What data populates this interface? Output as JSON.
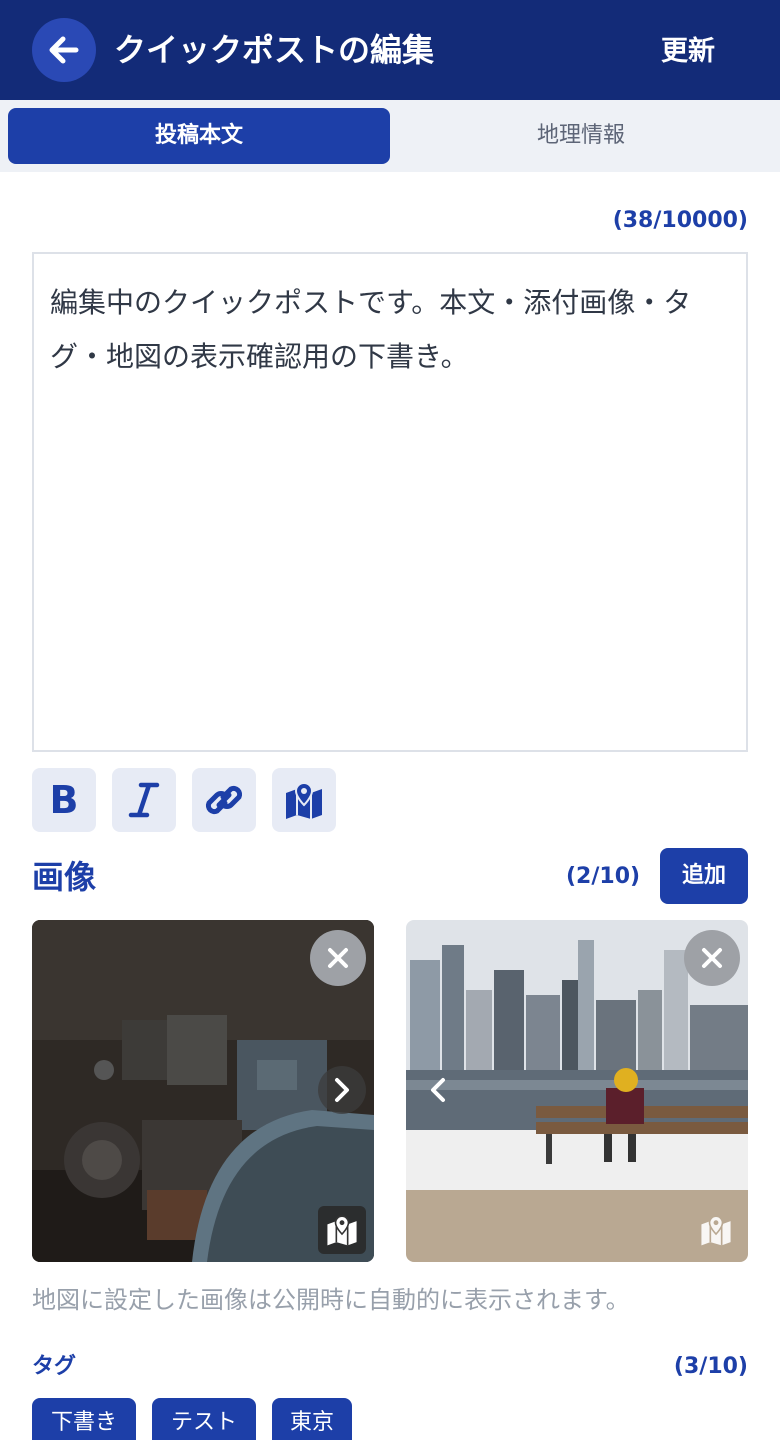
{
  "header": {
    "title": "クイックポストの編集",
    "update_label": "更新",
    "color": "#132b78"
  },
  "tabs": [
    {
      "label": "投稿本文",
      "active": true
    },
    {
      "label": "地理情報",
      "active": false
    }
  ],
  "editor": {
    "char_count": "(38/10000)",
    "text": "編集中のクイックポストです。本文・添付画像・タグ・地図の表示確認用の下書き。",
    "toolbar": [
      "bold-icon",
      "italic-icon",
      "link-icon",
      "map-icon"
    ]
  },
  "images": {
    "title": "画像",
    "count": "(2/10)",
    "add_label": "追加",
    "items": [
      {
        "description_icon": "machinery-photo",
        "has_next": true,
        "map_set": true
      },
      {
        "description_icon": "city-bench-photo",
        "has_prev": true,
        "map_set": false
      }
    ]
  },
  "hint": "地図に設定した画像は公開時に自動的に表示されます。",
  "tags": {
    "title": "タグ",
    "count": "(3/10)",
    "items": [
      "下書き",
      "テスト",
      "東京"
    ]
  },
  "colors": {
    "accent": "#1d3fa8",
    "tab_background": "#eef1f6",
    "toolbar_button": "#e7ebf5"
  }
}
